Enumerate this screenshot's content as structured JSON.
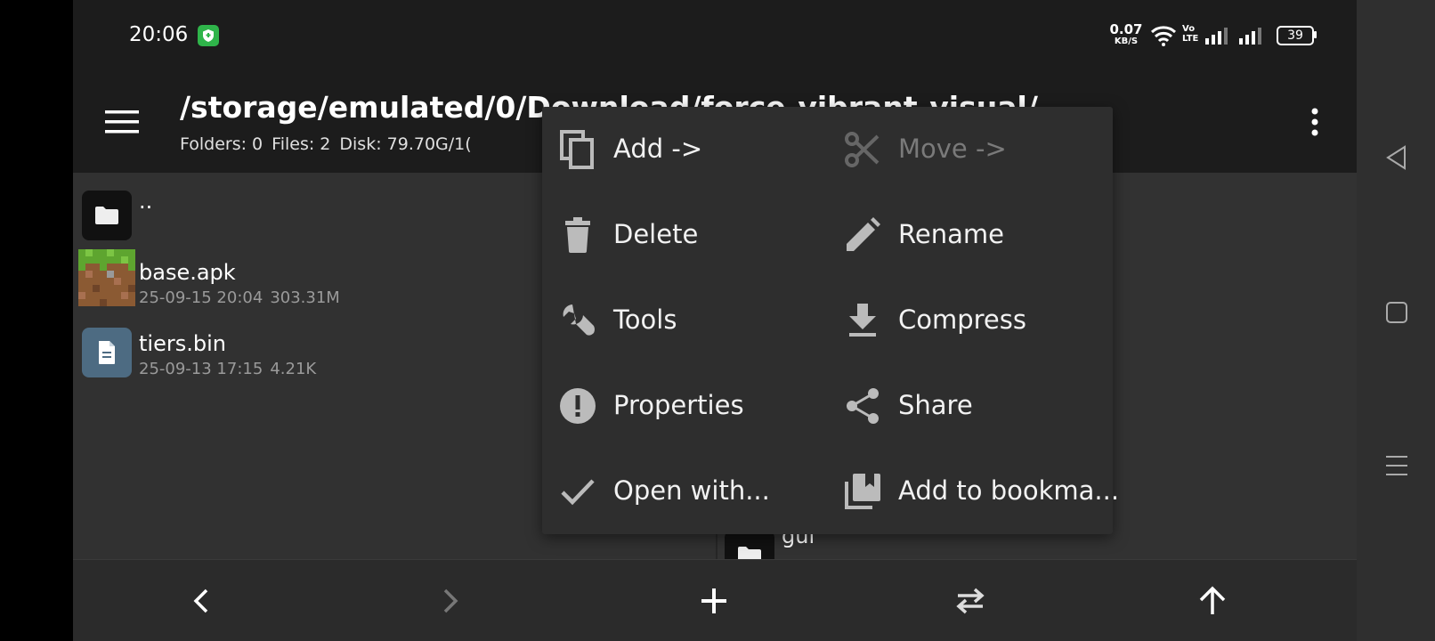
{
  "status_bar": {
    "time": "20:06",
    "net_speed_value": "0.07",
    "net_speed_unit": "KB/S",
    "volte_top": "Vo",
    "volte_bottom": "LTE",
    "battery": "39"
  },
  "header": {
    "path": "/storage/emulated/0/Download/force-vibrant-visual/",
    "folders": "Folders: 0",
    "files": "Files: 2",
    "disk": "Disk: 79.70G/1("
  },
  "files": [
    {
      "name": "..",
      "date": "",
      "size": "",
      "icon": "folder-icon"
    },
    {
      "name": "base.apk",
      "date": "25-09-15 20:04",
      "size": "303.31M",
      "icon": "apk-thumbnail"
    },
    {
      "name": "tiers.bin",
      "date": "25-09-13 17:15",
      "size": "4.21K",
      "icon": "file-icon"
    }
  ],
  "right_pane": {
    "partial_item": "gui"
  },
  "context_menu": {
    "items": [
      {
        "label": "Add ->",
        "icon": "copy-icon",
        "enabled": true
      },
      {
        "label": "Move ->",
        "icon": "scissors-icon",
        "enabled": false
      },
      {
        "label": "Delete",
        "icon": "trash-icon",
        "enabled": true
      },
      {
        "label": "Rename",
        "icon": "pencil-icon",
        "enabled": true
      },
      {
        "label": "Tools",
        "icon": "wrench-icon",
        "enabled": true
      },
      {
        "label": "Compress",
        "icon": "download-icon",
        "enabled": true
      },
      {
        "label": "Properties",
        "icon": "info-icon",
        "enabled": true
      },
      {
        "label": "Share",
        "icon": "share-icon",
        "enabled": true
      },
      {
        "label": "Open with...",
        "icon": "check-icon",
        "enabled": true
      },
      {
        "label": "Add to bookma...",
        "icon": "bookmark-icon",
        "enabled": true
      }
    ]
  },
  "colors": {
    "background": "#313131",
    "topbar": "#1c1c1c",
    "menu": "#2e2e2e",
    "vpn_badge": "#2fb44a",
    "file_icon_bg": "#4d6b82"
  }
}
